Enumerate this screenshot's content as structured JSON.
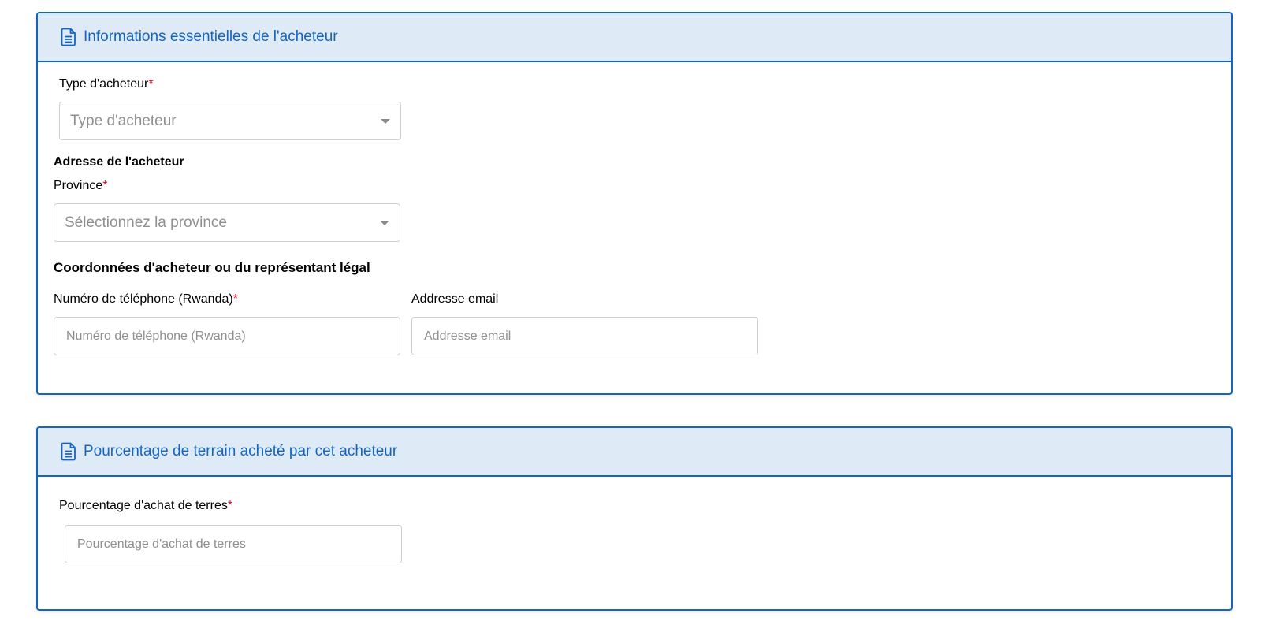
{
  "buyer_info": {
    "title": "Informations essentielles de l'acheteur",
    "buyer_type": {
      "label": "Type d'acheteur",
      "required_mark": "*",
      "placeholder": "Type d'acheteur"
    },
    "address_title": "Adresse de l'acheteur",
    "province": {
      "label": "Province",
      "required_mark": "*",
      "placeholder": "Sélectionnez la province"
    },
    "contact_title": "Coordonnées d'acheteur ou du représentant légal",
    "phone": {
      "label": "Numéro de téléphone (Rwanda)",
      "required_mark": "*",
      "placeholder": "Numéro de téléphone (Rwanda)"
    },
    "email": {
      "label": "Addresse email",
      "placeholder": "Addresse email"
    }
  },
  "land_percentage": {
    "title": "Pourcentage de terrain acheté par cet acheteur",
    "percentage": {
      "label": "Pourcentage d'achat de terres",
      "required_mark": "*",
      "placeholder": "Pourcentage d'achat de terres"
    }
  },
  "icons": {
    "header_icon": "document-icon"
  },
  "colors": {
    "accent": "#1565c0",
    "header_bg": "#deebf7",
    "required": "#e3001b",
    "placeholder": "#8f8f8f",
    "input_border": "#cfcfcf"
  }
}
